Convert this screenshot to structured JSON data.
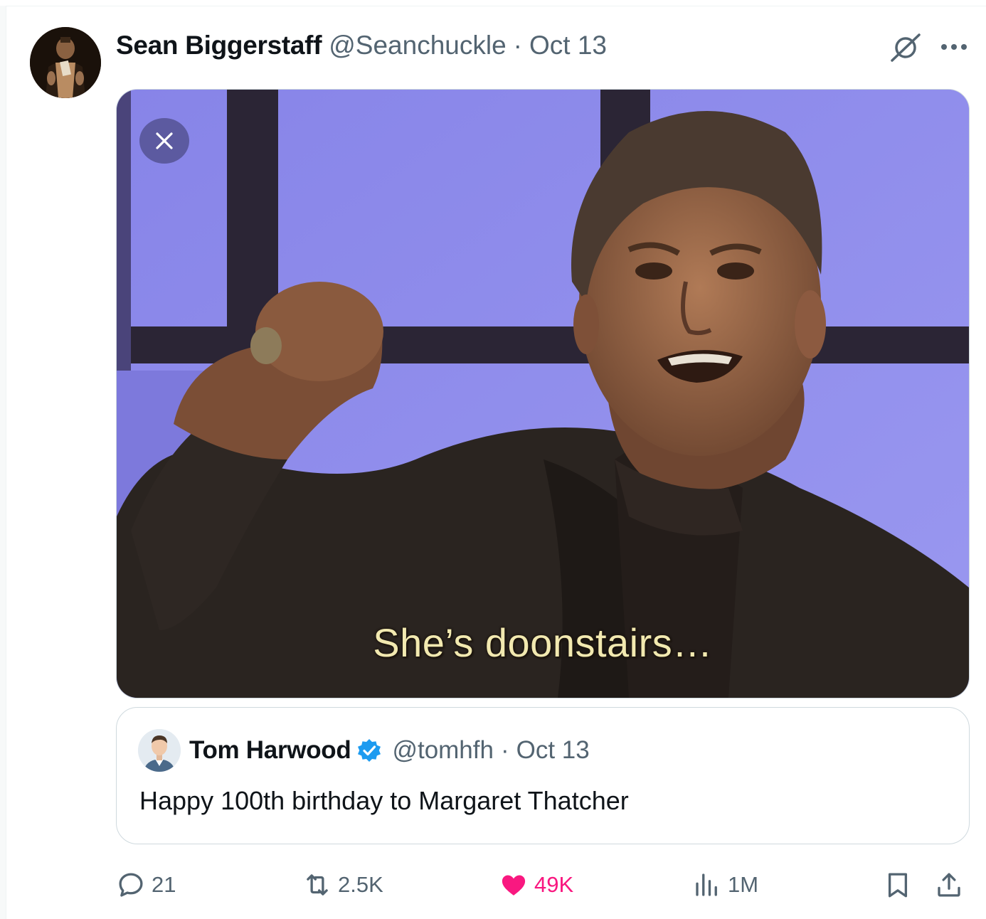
{
  "tweet": {
    "author_name": "Sean Biggerstaff",
    "author_handle": "@Seanchuckle",
    "separator": "·",
    "date": "Oct 13",
    "media": {
      "subtitle": "She’s doonstairs…"
    },
    "quoted": {
      "author_name": "Tom Harwood",
      "author_handle": "@tomhfh",
      "separator": "·",
      "date": "Oct 13",
      "text": "Happy 100th birthday to Margaret Thatcher"
    },
    "actions": {
      "replies": "21",
      "reposts": "2.5K",
      "likes": "49K",
      "views": "1M"
    }
  },
  "icons": {
    "top_right": [
      "grok-icon",
      "more-icon"
    ],
    "actions": [
      "reply-icon",
      "repost-icon",
      "like-icon",
      "views-icon",
      "bookmark-icon",
      "share-icon"
    ]
  },
  "colors": {
    "like_accent": "#f91880",
    "verified": "#1d9bf0",
    "secondary_text": "#536471",
    "background_purple": "#8b86ec"
  }
}
